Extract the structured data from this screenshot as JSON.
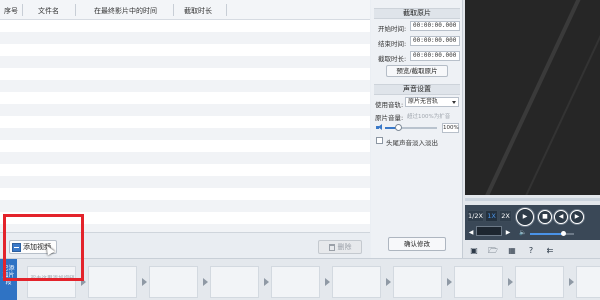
{
  "file_list": {
    "columns": [
      "序号",
      "文件名",
      "在最终影片中的时间",
      "截取时长"
    ]
  },
  "footer": {
    "add_video_label": "添加视频",
    "delete_label": "删除"
  },
  "settings": {
    "clip_section_title": "截取原片",
    "start_time_label": "开始时间:",
    "start_time_value": "00:00:00.000",
    "end_time_label": "结束时间:",
    "end_time_value": "00:00:00.000",
    "duration_label": "截取时长:",
    "duration_value": "00:00:00.000",
    "preview_button": "预览/截取原片",
    "audio_section_title": "声音设置",
    "track_label": "使用音轨:",
    "track_value": "原片无音轨",
    "volume_label": "原片音量:",
    "volume_hint": "超过100%为扩音",
    "volume_value": "100%",
    "volume_fraction": 0.25,
    "fade_label": "头尾声音淡入淡出",
    "fade_checked": false,
    "confirm_button": "确认修改"
  },
  "player": {
    "speed_half": "1/2X",
    "speed_normal": "1X",
    "speed_double": "2X",
    "progress_fraction": 0.0,
    "volume_fraction": 0.75
  },
  "timeline": {
    "tab_label": "已添加片段",
    "slot1_text": "双击这里添加视频"
  },
  "colors": {
    "accent": "#3a79c8",
    "highlight": "#e3232b",
    "screen": "#262626"
  }
}
